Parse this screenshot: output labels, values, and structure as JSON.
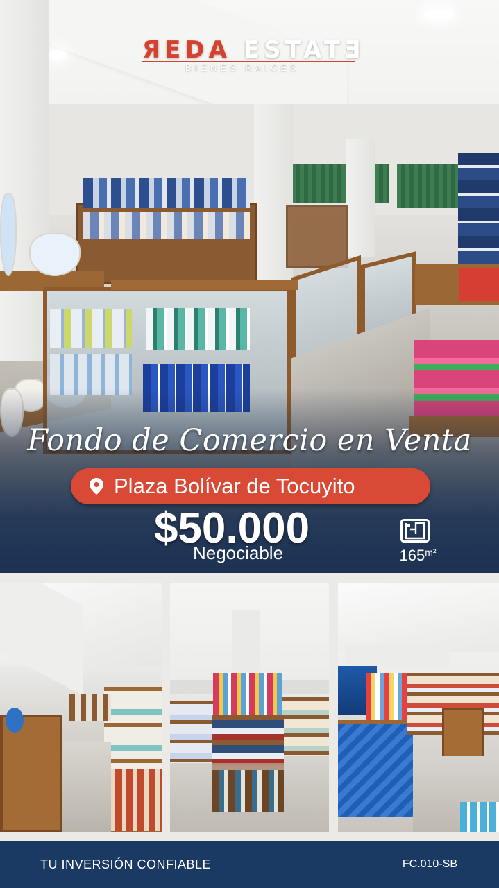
{
  "brand": {
    "logo_part1": "ЯEDA",
    "logo_part2": "ESTATƎ",
    "subtitle": "BIENES RAICES"
  },
  "listing": {
    "headline": "Fondo de Comercio en Venta",
    "location": "Plaza Bolívar de Tocuyito",
    "price": "$50.000",
    "price_note": "Negociable",
    "area_value": "165",
    "area_unit": "m²"
  },
  "icons": {
    "location": "location-pin-icon",
    "area": "floor-plan-icon"
  },
  "footer": {
    "tagline": "TU INVERSIÓN CONFIABLE",
    "reference": "FC.010-SB"
  },
  "colors": {
    "accent_red": "#d84a35",
    "navy": "#1b3a63"
  }
}
